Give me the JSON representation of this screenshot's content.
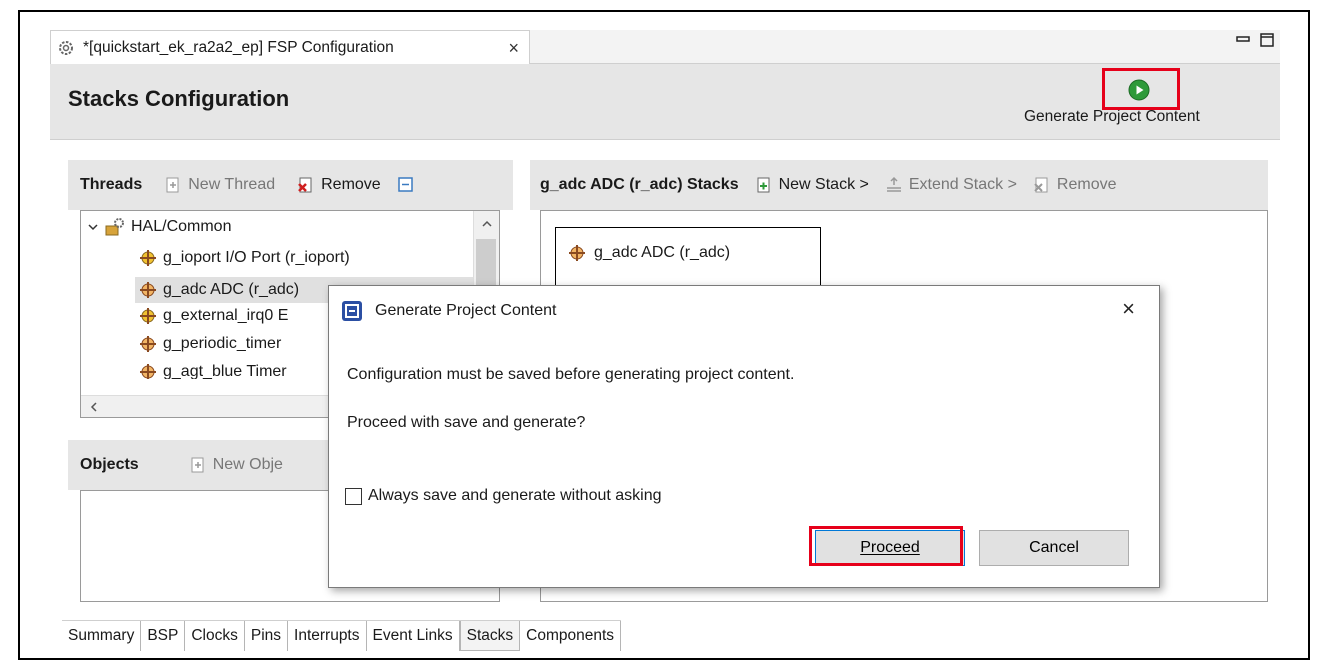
{
  "editor_tab": {
    "title": "*[quickstart_ek_ra2a2_ep] FSP Configuration",
    "close_glyph": "×",
    "icon": "gear-icon"
  },
  "window_controls": {
    "minimize": "▭",
    "maximize": "🗖"
  },
  "header": {
    "title": "Stacks Configuration",
    "generate_label": "Generate Project Content",
    "generate_icon": "play-icon"
  },
  "threads": {
    "title": "Threads",
    "new_thread": "New Thread",
    "remove": "Remove",
    "tree": {
      "group_label": "HAL/Common",
      "items": [
        "g_ioport I/O Port (r_ioport)",
        "g_adc ADC (r_adc)",
        "g_external_irq0 E",
        "g_periodic_timer",
        "g_agt_blue Timer"
      ]
    }
  },
  "objects": {
    "title": "Objects",
    "new_object": "New Obje"
  },
  "stacks": {
    "title": "g_adc ADC (r_adc) Stacks",
    "new_stack": "New Stack >",
    "extend_stack": "Extend Stack >",
    "remove": "Remove",
    "node_label": "g_adc ADC (r_adc)"
  },
  "bottom_tabs": [
    "Summary",
    "BSP",
    "Clocks",
    "Pins",
    "Interrupts",
    "Event Links",
    "Stacks",
    "Components"
  ],
  "active_bottom_tab": "Stacks",
  "dialog": {
    "title": "Generate Project Content",
    "close_glyph": "×",
    "message": "Configuration must be saved before generating project content.",
    "question": "Proceed with save and generate?",
    "checkbox_label": "Always save and generate without asking",
    "checkbox_checked": false,
    "proceed_button": "Proceed",
    "cancel_button": "Cancel"
  },
  "colors": {
    "highlight": "#e6001a",
    "accent": "#0078d7",
    "panel": "#e6e6e6"
  }
}
